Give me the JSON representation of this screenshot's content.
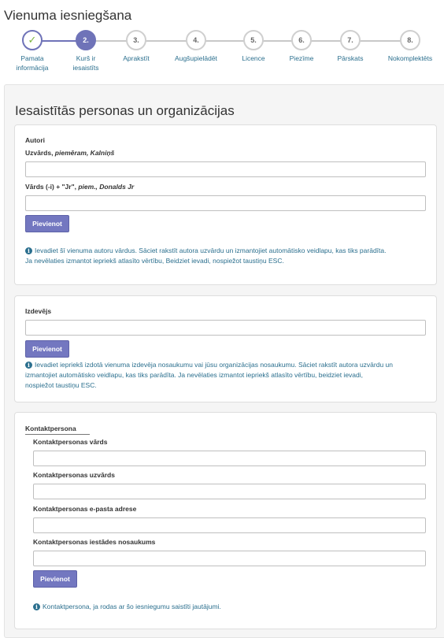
{
  "page_title": "Vienuma iesniegšana",
  "steps": [
    {
      "number": "✓",
      "label_lines": [
        "Pamata",
        "informācija"
      ],
      "state": "done"
    },
    {
      "number": "2.",
      "label_lines": [
        "Kurš ir",
        "iesaistīts"
      ],
      "state": "active"
    },
    {
      "number": "3.",
      "label_lines": [
        "Aprakstīt"
      ],
      "state": "pending"
    },
    {
      "number": "4.",
      "label_lines": [
        "Augšupielādēt"
      ],
      "state": "pending"
    },
    {
      "number": "5.",
      "label_lines": [
        "Licence"
      ],
      "state": "pending"
    },
    {
      "number": "6.",
      "label_lines": [
        "Piezīme"
      ],
      "state": "pending"
    },
    {
      "number": "7.",
      "label_lines": [
        "Pārskats"
      ],
      "state": "pending"
    },
    {
      "number": "8.",
      "label_lines": [
        "Nokomplektēts"
      ],
      "state": "pending"
    }
  ],
  "section_title": "Iesaistītās personas un organizācijas",
  "authors": {
    "legend": "Autori",
    "surname_label_prefix": "Uzvārds, ",
    "surname_label_example": "piemēram, Kalniņš",
    "surname_value": "",
    "given_label_prefix": "Vārds (-i) + \"Jr\", ",
    "given_label_example": "piem., Donalds Jr",
    "given_value": "",
    "add_button": "Pievienot",
    "help_line1": "Ievadiet šī vienuma autoru vārdus. Sāciet rakstīt autora uzvārdu un izmantojiet automātisko veidlapu, kas tiks parādīta.",
    "help_line2": "Ja nevēlaties izmantot iepriekš atlasīto vērtību, Beidziet ievadi, nospiežot taustiņu ESC."
  },
  "publisher": {
    "label": "Izdevējs",
    "value": "",
    "add_button": "Pievienot",
    "help_line1": "Ievadiet iepriekš izdotā vienuma izdevēja nosaukumu vai jūsu organizācijas nosaukumu. Sāciet rakstīt autora uzvārdu un",
    "help_line2": "izmantojiet automātisko veidlapu, kas tiks parādīta. Ja nevēlaties izmantot iepriekš atlasīto vērtību, beidziet ievadi,",
    "help_line3": "nospiežot taustiņu ESC."
  },
  "contact": {
    "legend": "Kontaktpersona",
    "first_name_label": "Kontaktpersonas vārds",
    "last_name_label": "Kontaktpersonas uzvārds",
    "email_label": "Kontaktpersonas e-pasta adrese",
    "institution_label": "Kontaktpersonas iestādes nosaukums",
    "first_name_value": "",
    "last_name_value": "",
    "email_value": "",
    "institution_value": "",
    "add_button": "Pievienot",
    "help": "Kontaktpersona, ja rodas ar šo iesniegumu saistīti jautājumi."
  },
  "colors": {
    "accent": "#7377c0",
    "done_check": "#7ab33c",
    "help_text": "#2b6f8e"
  }
}
